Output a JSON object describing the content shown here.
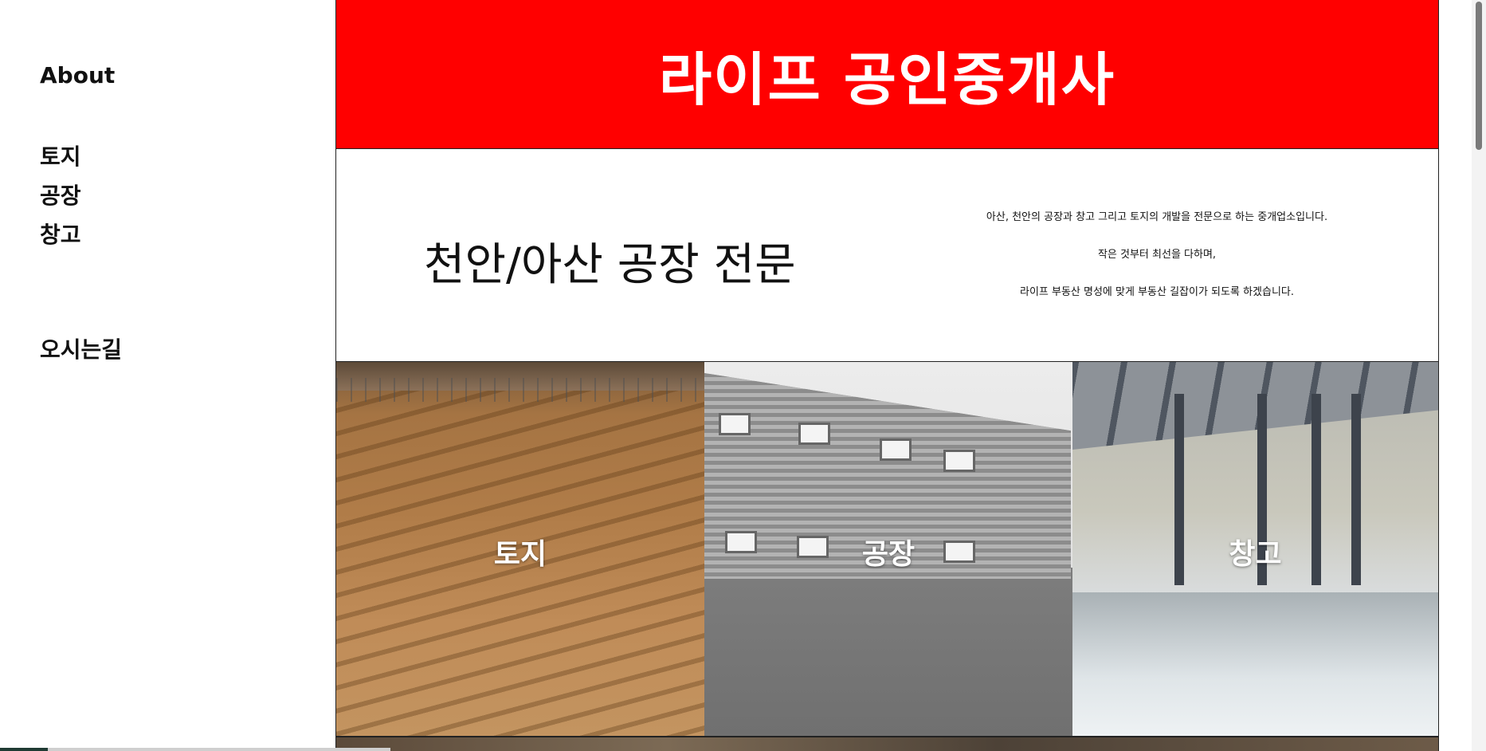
{
  "sidebar": {
    "about": "About",
    "land": "토지",
    "factory": "공장",
    "warehouse": "창고",
    "directions": "오시는길"
  },
  "header": {
    "title": "라이프 공인중개사"
  },
  "intro": {
    "title": "천안/아산 공장 전문",
    "lines": [
      "아산, 천안의 공장과 창고 그리고 토지의 개발을 전문으로 하는 중개업소입니다.",
      "작은 것부터 최선을 다하며,",
      "라이프 부동산 명성에 맞게 부동산 길잡이가 되도록 하겠습니다."
    ]
  },
  "tiles": [
    {
      "label": "토지"
    },
    {
      "label": "공장"
    },
    {
      "label": "창고"
    }
  ],
  "colors": {
    "header_bg": "#ff0000",
    "header_text": "#ffffff"
  }
}
